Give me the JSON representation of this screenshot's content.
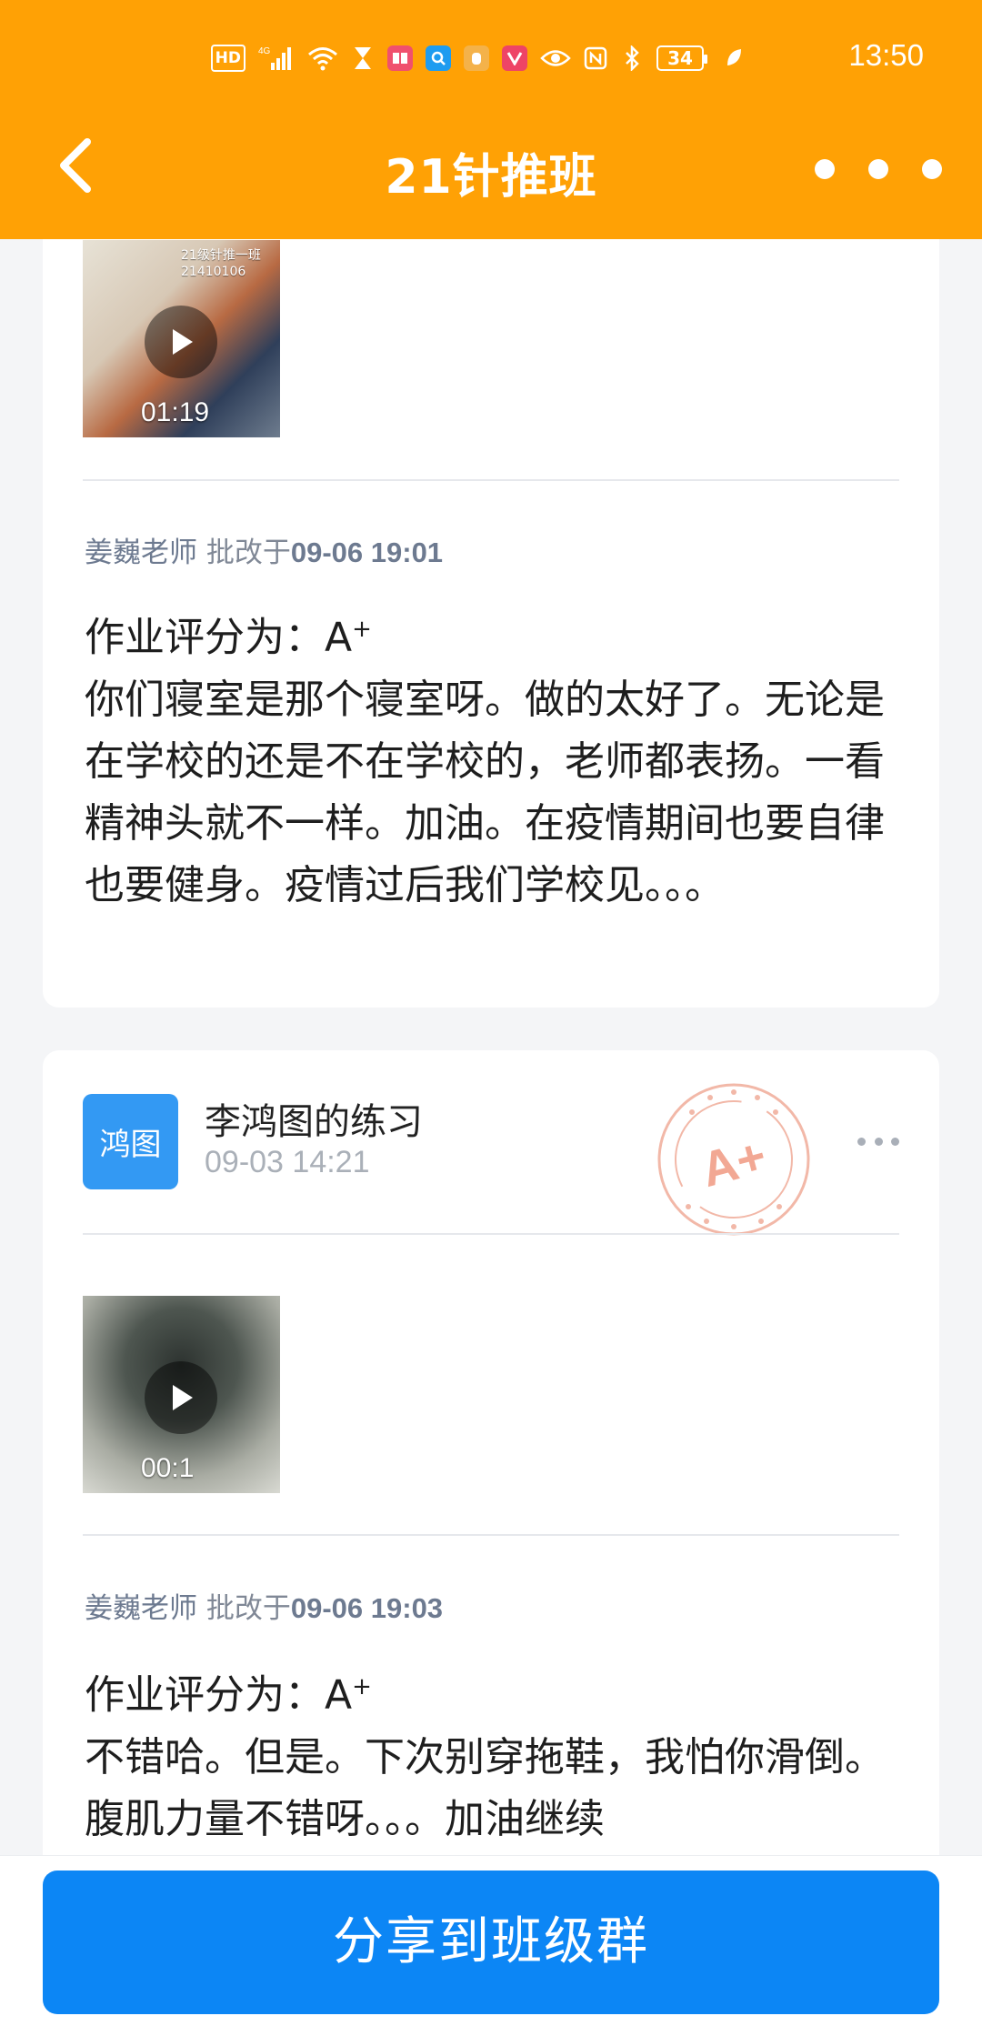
{
  "status_bar": {
    "time": "13:50",
    "battery": "34",
    "signal_label": "4G",
    "hd_label": "HD",
    "icons": [
      "hd-icon",
      "signal-icon",
      "wifi-icon",
      "hourglass-icon",
      "book-app-icon",
      "search-app-icon",
      "hand-app-icon",
      "v-app-icon",
      "eye-icon",
      "nfc-icon",
      "bluetooth-icon",
      "battery-icon",
      "leaf-icon"
    ]
  },
  "header": {
    "title": "21针推班",
    "background": "#FFA105"
  },
  "card1": {
    "video_duration": "01:19",
    "video_caption": "21级针推一班\n21410106",
    "reviewer_name": "姜巍老师",
    "reviewed_prefix": " 批改于",
    "reviewed_at": "09-06 19:01",
    "score_label": "作业评分为：A",
    "score_sup": "+",
    "comment": "你们寝室是那个寝室呀。做的太好了。无论是在学校的还是不在学校的，老师都表扬。一看精神头就不一样。加油。在疫情期间也要自律也要健身。疫情过后我们学校见。。。"
  },
  "card2": {
    "avatar_text": "鸿图",
    "student_title": "李鸿图的练习",
    "posted_at": "09-03 14:21",
    "grade_stamp": "A+",
    "video_duration": "00:1",
    "reviewer_name": "姜巍老师",
    "reviewed_prefix": " 批改于",
    "reviewed_at": "09-06 19:03",
    "score_label": "作业评分为：A",
    "score_sup": "+",
    "comment": "不错哈。但是。下次别穿拖鞋，我怕你滑倒。腹肌力量不错呀。。。加油继续"
  },
  "bottom": {
    "share_label": "分享到班级群",
    "button_color": "#0C86F5"
  }
}
